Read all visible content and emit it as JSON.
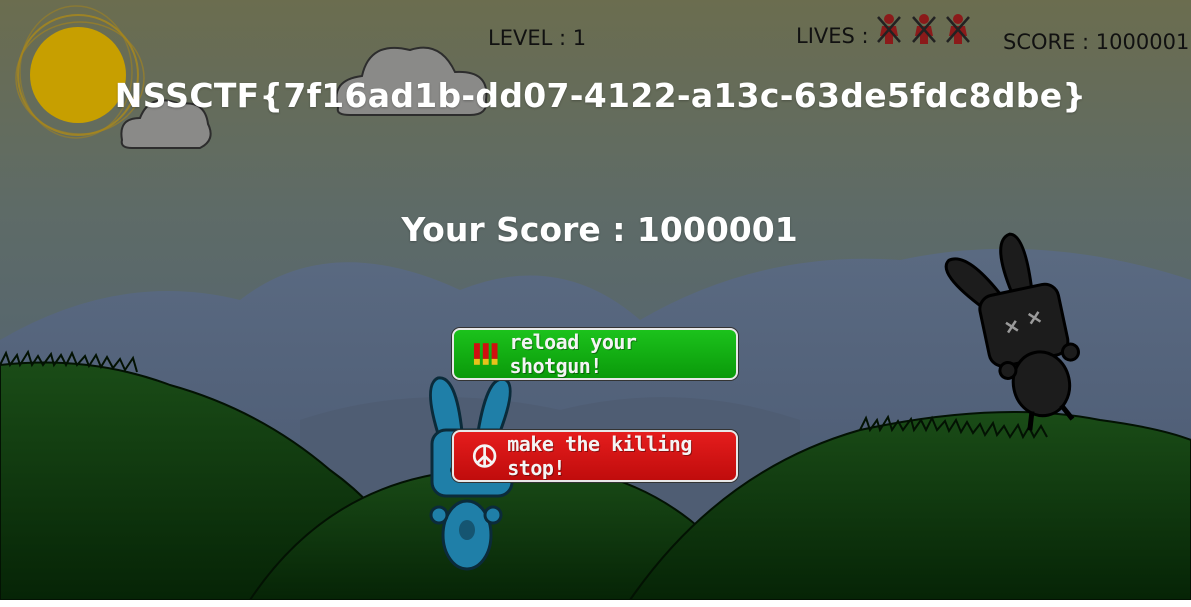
{
  "hud": {
    "level_text": "LEVEL : 1",
    "lives_text": "LIVES :",
    "lives_count": 3,
    "score_text": "SCORE : 1000001"
  },
  "result": {
    "flag": "NSSCTF{7f16ad1b-dd07-4122-a13c-63de5fdc8dbe}",
    "final_score_text": "Your Score : 1000001"
  },
  "buttons": {
    "reload_label": "reload your shotgun!",
    "reload_icon": "shotgun-shells-icon",
    "stop_label": "make the killing stop!",
    "stop_icon": "peace-sign-icon"
  },
  "colors": {
    "sky_top": "#6a6d50",
    "sky_bottom": "#4d5e78",
    "grass": "#0f3d0f",
    "sun": "#c9a000",
    "reload_button": "#10ad10",
    "stop_button": "#d31313"
  }
}
